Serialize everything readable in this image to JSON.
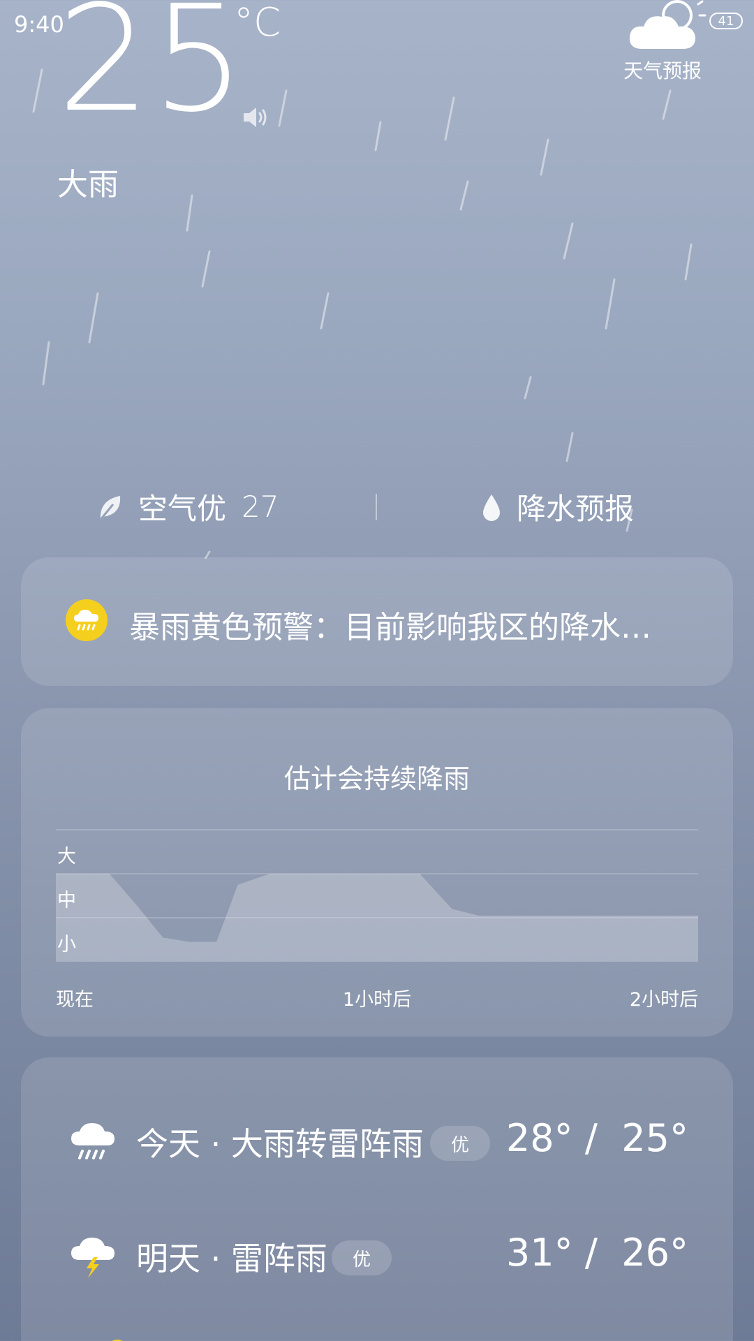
{
  "status_bar": {
    "time": "9:40",
    "battery": "41"
  },
  "current": {
    "temperature": "25",
    "unit": "°C",
    "condition": "大雨"
  },
  "app": {
    "label": "天气预报"
  },
  "info": {
    "air_label": "空气优",
    "air_value": "27",
    "precip_label": "降水预报"
  },
  "alert": {
    "text": "暴雨黄色预警：目前影响我区的降水…",
    "icon_color": "#f5cf1d"
  },
  "rain_forecast": {
    "title": "估计会持续降雨"
  },
  "chart_data": {
    "type": "area",
    "title": "估计会持续降雨",
    "y_levels": [
      "大",
      "中",
      "小"
    ],
    "x_tick_labels": [
      "现在",
      "1小时后",
      "2小时后"
    ],
    "x_minutes": [
      0,
      10,
      15,
      20,
      25,
      30,
      34,
      40,
      44,
      55,
      68,
      74,
      79,
      120
    ],
    "intensity": [
      2,
      2,
      1.3,
      0.55,
      0.45,
      0.45,
      1.75,
      2,
      2,
      2,
      2,
      1.2,
      1.05,
      1.05
    ],
    "ylim": [
      0,
      3
    ],
    "grid": true
  },
  "forecast": [
    {
      "day": "今天 · 大雨转雷阵雨",
      "aqi": "优",
      "high": "28°",
      "low": "25°",
      "icon": "rain-cloud-icon"
    },
    {
      "day": "明天 · 雷阵雨",
      "aqi": "优",
      "high": "31°",
      "low": "26°",
      "icon": "thunderstorm-icon"
    }
  ]
}
